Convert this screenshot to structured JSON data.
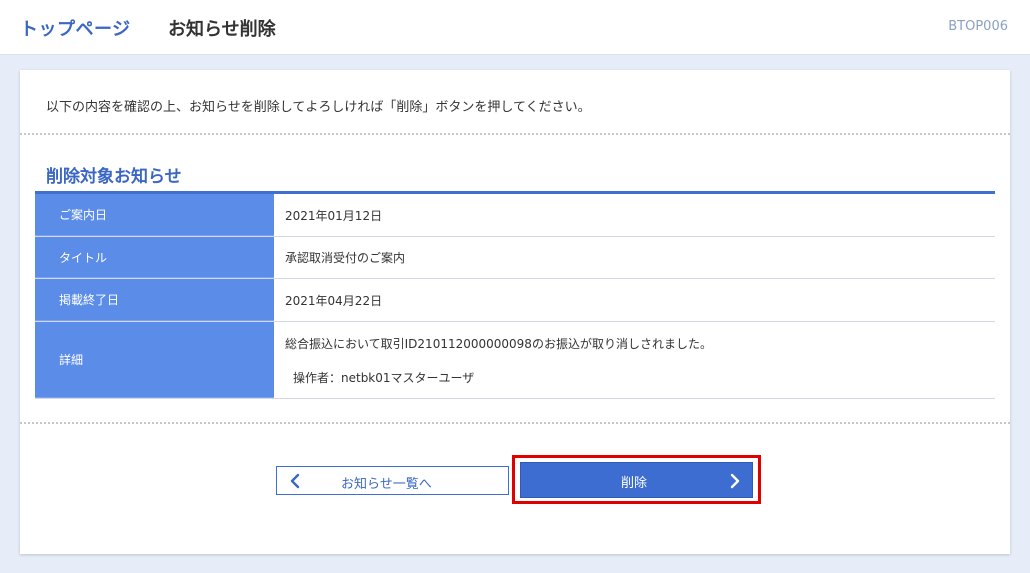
{
  "header": {
    "top_link": "トップページ",
    "page_title": "お知らせ削除",
    "screen_id": "BTOP006"
  },
  "main": {
    "message": "以下の内容を確認の上、お知らせを削除してよろしければ「削除」ボタンを押してください。",
    "section_title": "削除対象お知らせ",
    "rows": [
      {
        "label": "ご案内日",
        "value": "2021年01月12日"
      },
      {
        "label": "タイトル",
        "value": "承認取消受付のご案内"
      },
      {
        "label": "掲載終了日",
        "value": "2021年04月22日"
      },
      {
        "label": "詳細",
        "value": "総合振込において取引ID210112000000098のお振込が取り消しされました。",
        "value2": "操作者：netbk01マスターユーザ"
      }
    ]
  },
  "buttons": {
    "back_label": "お知らせ一覧へ",
    "delete_label": "削除"
  },
  "icons": {
    "back": "chevron-left-icon",
    "forward": "chevron-right-icon"
  },
  "colors": {
    "accent": "#3a66c4",
    "header_cell": "#5b8ce8",
    "primary_button": "#3d6dd1",
    "highlight": "#e00000"
  }
}
